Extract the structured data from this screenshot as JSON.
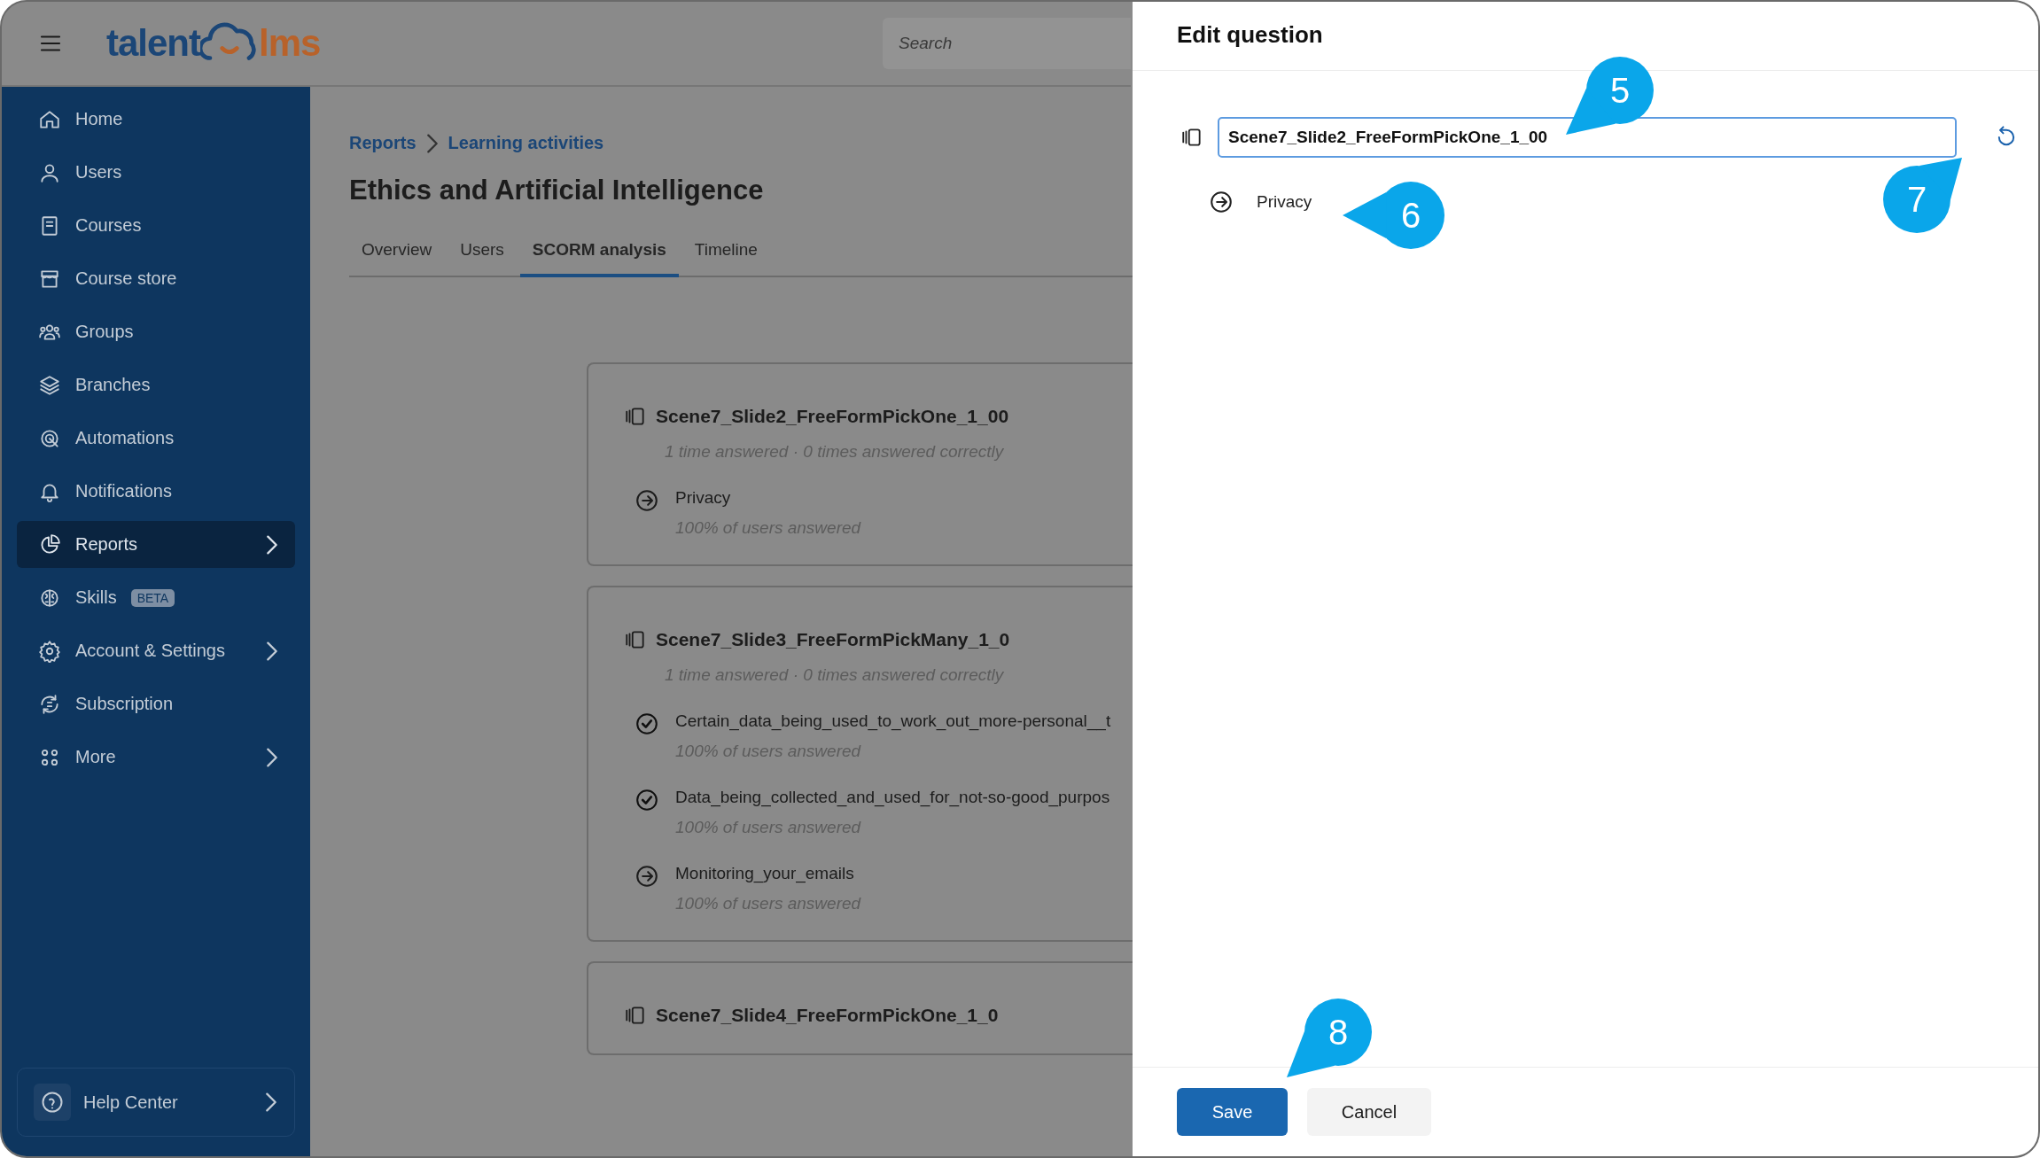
{
  "header": {
    "logo": {
      "left": "talent",
      "right": "lms"
    },
    "search": {
      "placeholder": "Search"
    }
  },
  "sidebar": {
    "items": [
      {
        "label": "Home",
        "selected": false,
        "has_submenu": false
      },
      {
        "label": "Users",
        "selected": false,
        "has_submenu": false
      },
      {
        "label": "Courses",
        "selected": false,
        "has_submenu": false
      },
      {
        "label": "Course store",
        "selected": false,
        "has_submenu": false
      },
      {
        "label": "Groups",
        "selected": false,
        "has_submenu": false
      },
      {
        "label": "Branches",
        "selected": false,
        "has_submenu": false
      },
      {
        "label": "Automations",
        "selected": false,
        "has_submenu": false
      },
      {
        "label": "Notifications",
        "selected": false,
        "has_submenu": false
      },
      {
        "label": "Reports",
        "selected": true,
        "has_submenu": true
      },
      {
        "label": "Skills",
        "selected": false,
        "has_submenu": false,
        "badge": "BETA"
      },
      {
        "label": "Account & Settings",
        "selected": false,
        "has_submenu": true
      },
      {
        "label": "Subscription",
        "selected": false,
        "has_submenu": false
      },
      {
        "label": "More",
        "selected": false,
        "has_submenu": true
      }
    ],
    "help": {
      "label": "Help Center"
    }
  },
  "breadcrumb": [
    "Reports",
    "Learning activities"
  ],
  "title": "Ethics and Artificial Intelligence",
  "tabs": [
    {
      "label": "Overview",
      "selected": false
    },
    {
      "label": "Users",
      "selected": false
    },
    {
      "label": "SCORM analysis",
      "selected": true
    },
    {
      "label": "Timeline",
      "selected": false
    }
  ],
  "questions": [
    {
      "title": "Scene7_Slide2_FreeFormPickOne_1_00",
      "stats": "1 time answered · 0 times answered correctly",
      "answers": [
        {
          "text": "Privacy",
          "share": "100% of users answered",
          "selected": false
        }
      ]
    },
    {
      "title": "Scene7_Slide3_FreeFormPickMany_1_0",
      "stats": "1 time answered · 0 times answered correctly",
      "answers": [
        {
          "text": "Certain_data_being_used_to_work_out_more-personal__t",
          "share": "100% of users answered",
          "selected": true
        },
        {
          "text": "Data_being_collected_and_used_for_not-so-good_purpos",
          "share": "100% of users answered",
          "selected": true
        },
        {
          "text": "Monitoring_your_emails",
          "share": "100% of users answered",
          "selected": false
        }
      ]
    },
    {
      "title": "Scene7_Slide4_FreeFormPickOne_1_0"
    }
  ],
  "drawer": {
    "title": "Edit question",
    "question_value": "Scene7_Slide2_FreeFormPickOne_1_00",
    "answers": [
      {
        "text": "Privacy"
      }
    ],
    "buttons": [
      {
        "label": "Save",
        "kind": "primary"
      },
      {
        "label": "Cancel",
        "kind": "secondary"
      }
    ]
  },
  "callouts": [
    {
      "label": "5"
    },
    {
      "label": "6"
    },
    {
      "label": "7"
    },
    {
      "label": "8"
    }
  ]
}
